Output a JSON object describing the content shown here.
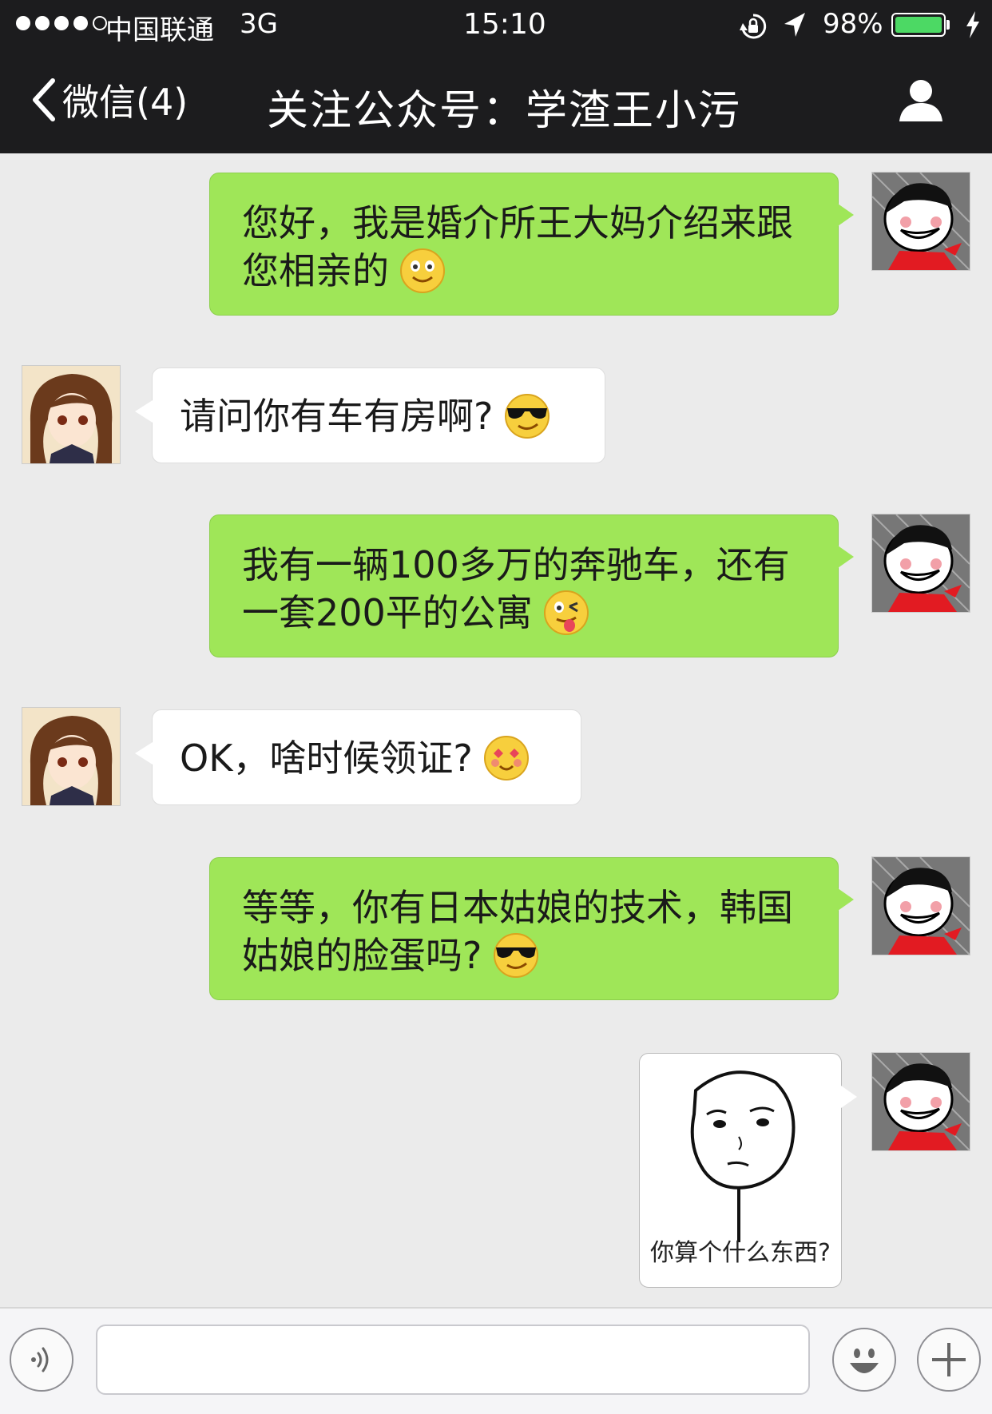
{
  "status_bar": {
    "carrier": "中国联通",
    "network": "3G",
    "time": "15:10",
    "battery_percent": "98%",
    "battery_level": 0.98,
    "signal_bars": 4,
    "icons": [
      "rotation-lock-icon",
      "location-arrow-icon",
      "battery-icon",
      "charging-bolt-icon"
    ]
  },
  "nav": {
    "back_label": "微信(4)",
    "title": "关注公众号：学渣王小污",
    "right_icon": "profile-icon"
  },
  "messages": [
    {
      "side": "right",
      "type": "text",
      "text": "您好，我是婚介所王大妈介绍来跟您相亲的",
      "emoji": "smile"
    },
    {
      "side": "left",
      "type": "text",
      "text": "请问你有车有房啊?",
      "emoji": "sunglasses"
    },
    {
      "side": "right",
      "type": "text",
      "text": "我有一辆100多万的奔驰车，还有一套200平的公寓",
      "emoji": "wink-tongue"
    },
    {
      "side": "left",
      "type": "text",
      "text": "OK，啥时候领证?",
      "emoji": "heart-eyes"
    },
    {
      "side": "right",
      "type": "text",
      "text": "等等，你有日本姑娘的技术，韩国姑娘的脸蛋吗?",
      "emoji": "sunglasses"
    },
    {
      "side": "right",
      "type": "image",
      "caption": "你算个什么东西?"
    }
  ],
  "input_bar": {
    "placeholder": "",
    "icons": [
      "voice-icon",
      "emoji-icon",
      "plus-icon"
    ]
  },
  "colors": {
    "nav_bg": "#1c1c1e",
    "chat_bg": "#ebebeb",
    "sent_bubble": "#9fe658",
    "received_bubble": "#ffffff",
    "battery_green": "#4cd964"
  }
}
